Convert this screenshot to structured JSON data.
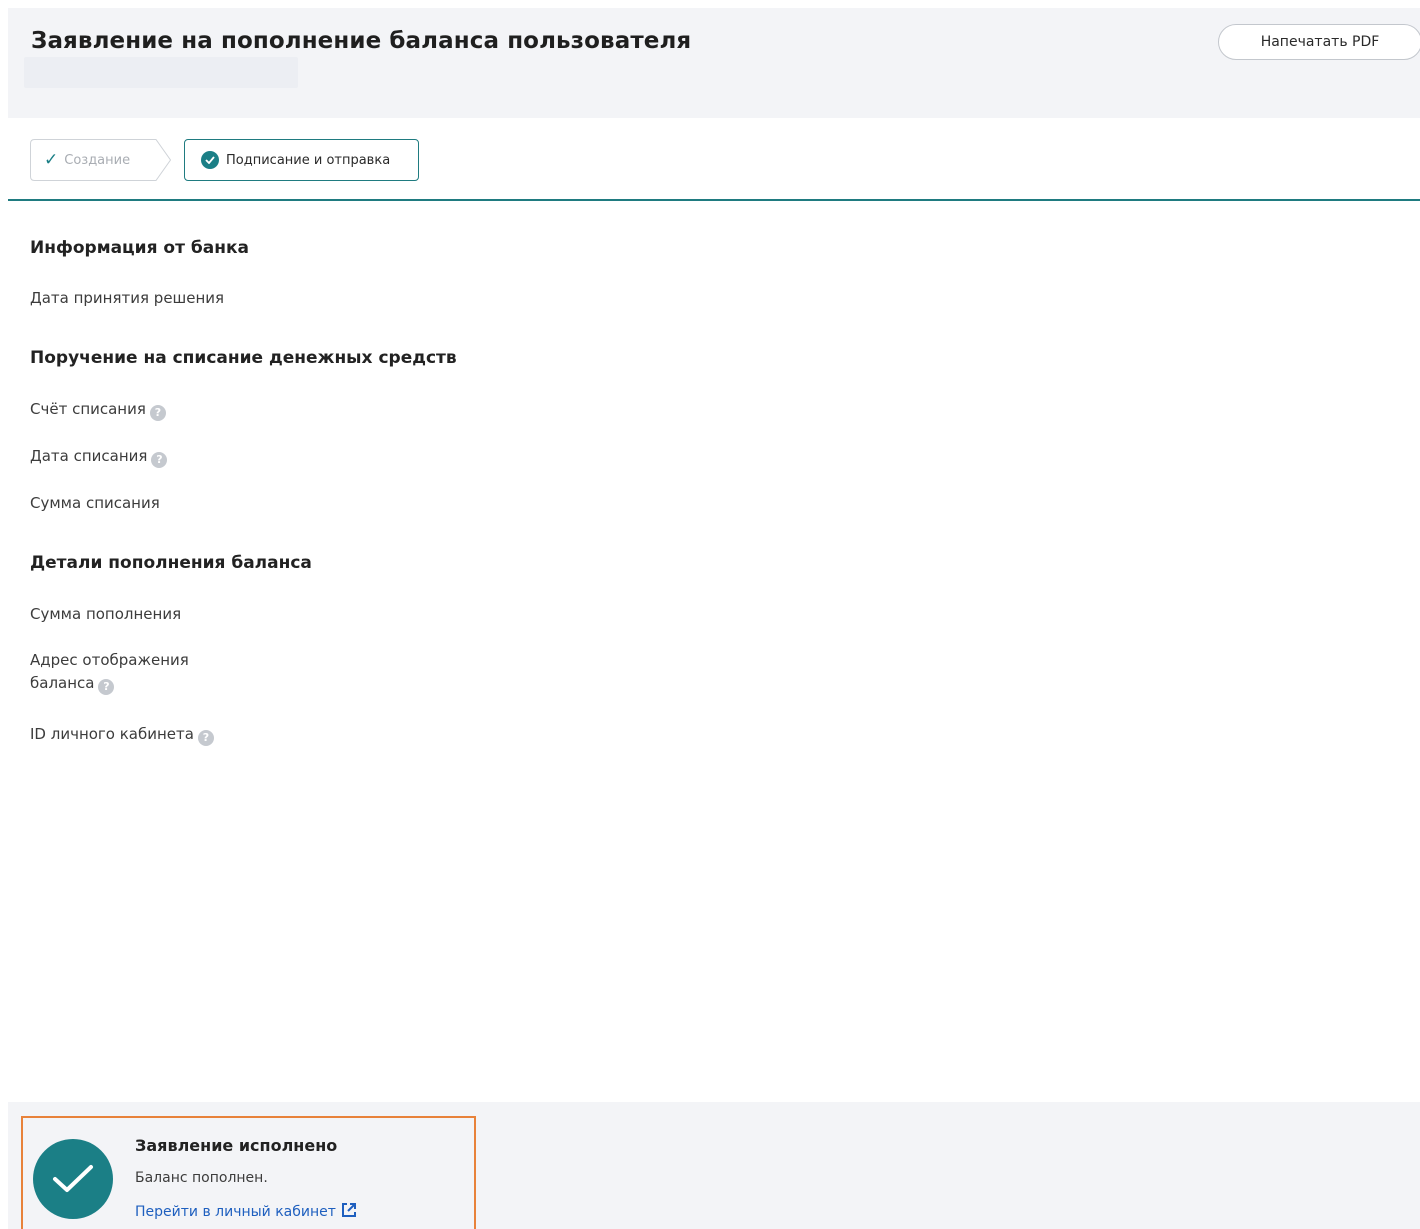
{
  "header": {
    "title": "Заявление на пополнение баланса пользователя",
    "print_button": "Напечатать PDF"
  },
  "steps": [
    {
      "label": "Создание",
      "state": "completed"
    },
    {
      "label": "Подписание и отправка",
      "state": "active"
    }
  ],
  "sections": {
    "bank_info": {
      "title": "Информация от банка",
      "fields": [
        "Дата принятия решения"
      ]
    },
    "debit_order": {
      "title": "Поручение на списание денежных средств",
      "fields": [
        "Счёт списания",
        "Дата списания",
        "Сумма списания"
      ]
    },
    "topup_details": {
      "title": "Детали пополнения баланса",
      "fields": [
        "Сумма пополнения",
        "Адрес отображения",
        "баланса",
        "ID личного кабинета"
      ]
    }
  },
  "status": {
    "title": "Заявление исполнено",
    "text": "Баланс пополнен.",
    "link": "Перейти в личный кабинет"
  },
  "icons": {
    "help": "question-circle-icon",
    "check": "check-icon",
    "external": "external-link-icon"
  },
  "colors": {
    "accent": "#1b7f86",
    "link": "#1e5fbf",
    "highlight_border": "#e8823a",
    "header_bg": "#f3f4f7"
  }
}
